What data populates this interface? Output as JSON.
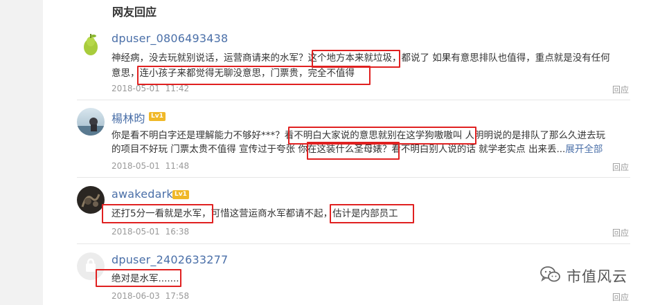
{
  "section": {
    "title": "网友回应"
  },
  "reply_label": "回应",
  "comments": [
    {
      "username": "dpuser_0806493438",
      "badge": "",
      "line1": "神经病，没去玩就别说话，运营商请来的水军？这个地方本来就垃圾，都说了 如果有意思排队也值得，重点就是没有任何",
      "line2": "意思，连小孩子来都觉得无聊没意思，门票贵，完全不值得",
      "date": "2018-05-01",
      "time": "11:42"
    },
    {
      "username": "楊林昀",
      "badge": "Lv1",
      "line1": "你是看不明白字还是理解能力不够好***？看不明白大家说的意思就别在这学狗嗷嗷叫 人明明说的是排队了那么久进去玩",
      "line2": "的项目不好玩 门票太贵不值得 宣传过于夸张 你在这装什么圣母婊？看不明白别人说的话 就学老实点 出来丢...",
      "expand": "展开全部",
      "date": "2018-05-01",
      "time": "11:48"
    },
    {
      "username": "awakedark",
      "badge": "Lv1",
      "line1": "还打5分一看就是水军，可惜这营运商水军都请不起，估计是内部员工",
      "date": "2018-05-01",
      "time": "16:38"
    },
    {
      "username": "dpuser_2402633277",
      "badge": "",
      "line1": "绝对是水军.......",
      "date": "2018-06-03",
      "time": "17:58"
    }
  ],
  "watermark": {
    "text": "市值风云",
    "icon": "wechat-icon"
  },
  "colors": {
    "highlight": "#e02020",
    "link": "#4a6fa8",
    "badge": "#f0b828"
  }
}
